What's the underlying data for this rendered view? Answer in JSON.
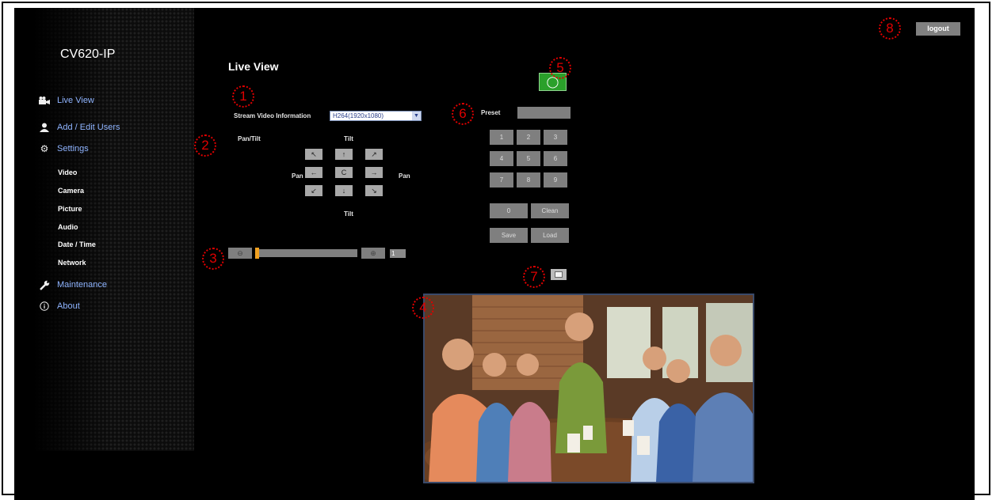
{
  "app": {
    "title": "CV620-IP"
  },
  "header": {
    "logout_label": "logout"
  },
  "sidebar": {
    "main_items": [
      {
        "label": "Live View",
        "icon": "camera-icon"
      },
      {
        "label": "Add / Edit Users",
        "icon": "user-icon"
      },
      {
        "label": "Settings",
        "icon": "gear-icon"
      },
      {
        "label": "Maintenance",
        "icon": "wrench-icon"
      },
      {
        "label": "About",
        "icon": "info-icon"
      }
    ],
    "settings_subitems": [
      "Video",
      "Camera",
      "Picture",
      "Audio",
      "Date / Time",
      "Network"
    ]
  },
  "main": {
    "page_title": "Live View",
    "stream_info_label": "Stream Video Information",
    "stream_select_value": "H264(1920x1080)",
    "ptz": {
      "pan_tilt_label": "Pan/Tilt",
      "tilt_top_label": "Tilt",
      "tilt_bottom_label": "Tilt",
      "pan_left_label": "Pan",
      "pan_right_label": "Pan",
      "buttons": [
        "↖",
        "↑",
        "↗",
        "←",
        "C",
        "→",
        "↙",
        "↓",
        "↘"
      ]
    },
    "zoom": {
      "value": "1",
      "level_fraction": 0.0
    },
    "preset": {
      "label": "Preset",
      "keys": [
        "1",
        "2",
        "3",
        "4",
        "5",
        "6",
        "7",
        "8",
        "9"
      ],
      "zero": "0",
      "clean": "Clean",
      "save": "Save",
      "load": "Load"
    }
  },
  "callouts": [
    "1",
    "2",
    "3",
    "4",
    "5",
    "6",
    "7",
    "8"
  ],
  "colors": {
    "accent_link": "#8fb4ff",
    "snapshot_green": "#2aa02a",
    "callout_red": "#e00000",
    "slider_orange": "#f0a020"
  }
}
